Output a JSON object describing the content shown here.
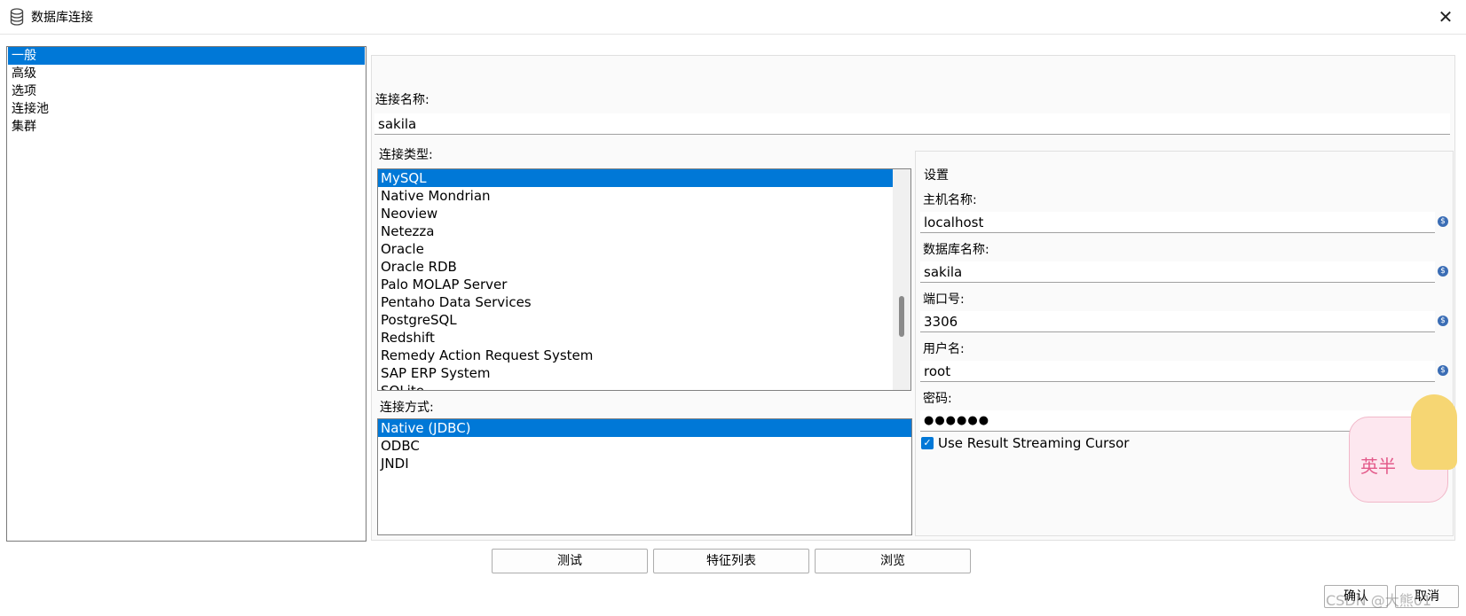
{
  "window": {
    "title": "数据库连接",
    "close_glyph": "✕"
  },
  "sidebar": {
    "items": [
      {
        "label": "一般",
        "selected": true
      },
      {
        "label": "高级",
        "selected": false
      },
      {
        "label": "选项",
        "selected": false
      },
      {
        "label": "连接池",
        "selected": false
      },
      {
        "label": "集群",
        "selected": false
      }
    ]
  },
  "general": {
    "connection_name_label": "连接名称:",
    "connection_name_value": "sakila",
    "connection_type_label": "连接类型:",
    "connection_types": [
      {
        "label": "MySQL",
        "selected": true
      },
      {
        "label": "Native Mondrian",
        "selected": false
      },
      {
        "label": "Neoview",
        "selected": false
      },
      {
        "label": "Netezza",
        "selected": false
      },
      {
        "label": "Oracle",
        "selected": false
      },
      {
        "label": "Oracle RDB",
        "selected": false
      },
      {
        "label": "Palo MOLAP Server",
        "selected": false
      },
      {
        "label": "Pentaho Data Services",
        "selected": false
      },
      {
        "label": "PostgreSQL",
        "selected": false
      },
      {
        "label": "Redshift",
        "selected": false
      },
      {
        "label": "Remedy Action Request System",
        "selected": false
      },
      {
        "label": "SAP ERP System",
        "selected": false
      },
      {
        "label": "SQLite",
        "selected": false
      }
    ],
    "access_label": "连接方式:",
    "access_methods": [
      {
        "label": "Native (JDBC)",
        "selected": true
      },
      {
        "label": "ODBC",
        "selected": false
      },
      {
        "label": "JNDI",
        "selected": false
      }
    ]
  },
  "settings": {
    "title": "设置",
    "host_label": "主机名称:",
    "host_value": "localhost",
    "db_label": "数据库名称:",
    "db_value": "sakila",
    "port_label": "端口号:",
    "port_value": "3306",
    "user_label": "用户名:",
    "user_value": "root",
    "password_label": "密码:",
    "password_value": "●●●●●●",
    "streaming_label": "Use Result Streaming Cursor",
    "streaming_checked": true,
    "var_glyph": "$"
  },
  "buttons": {
    "test": "测试",
    "features": "特征列表",
    "explore": "浏览",
    "ok": "确认",
    "cancel": "取消"
  },
  "watermark": {
    "text": "CSDN @大熊01",
    "sticker_text": "英半"
  },
  "colors": {
    "selection": "#0078d7",
    "var_icon": "#3a6db5"
  }
}
